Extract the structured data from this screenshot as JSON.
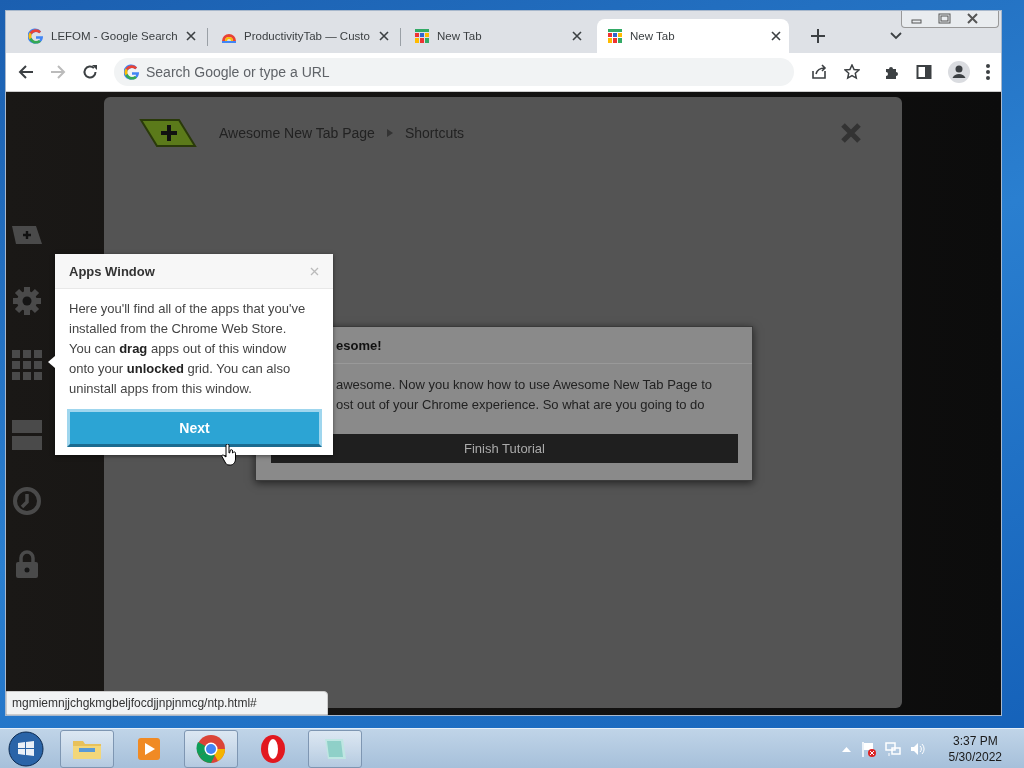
{
  "browser": {
    "tabs": [
      {
        "title": "LEFOM - Google Search",
        "kind": "google",
        "selected": false
      },
      {
        "title": "ProductivityTab — Custo",
        "kind": "rainbow",
        "selected": false
      },
      {
        "title": "New Tab",
        "kind": "grid",
        "selected": false
      },
      {
        "title": "New Tab",
        "kind": "grid",
        "selected": true
      }
    ],
    "omnibox": {
      "placeholder": "Search Google or type a URL"
    },
    "status_url": "mgmiemnjjchgkmgbeljfocdjjnpjnmcg/ntp.html#"
  },
  "sidebar": {
    "items": [
      {
        "kind": "add"
      },
      {
        "kind": "settings"
      },
      {
        "kind": "apps"
      },
      {
        "kind": "widgets"
      },
      {
        "kind": "history"
      },
      {
        "kind": "lock"
      }
    ]
  },
  "panel": {
    "breadcrumb": [
      "Awesome New Tab Page",
      "Shortcuts"
    ]
  },
  "dialog": {
    "title": "esome!",
    "lines": [
      "awesome. Now you know how to use Awesome New Tab Page to",
      "ost out of your Chrome experience. So what are you going to do"
    ],
    "button": "Finish Tutorial"
  },
  "popover": {
    "title": "Apps Window",
    "text": "Here you'll find all of the apps that you've installed from the Chrome Web Store. You can **drag** apps out of this window onto your **unlocked** grid. You can also uninstall apps from this window.",
    "button": "Next"
  },
  "taskbar": {
    "apps": [
      {
        "kind": "explorer",
        "running": true
      },
      {
        "kind": "media",
        "running": false
      },
      {
        "kind": "chrome",
        "running": true
      },
      {
        "kind": "opera",
        "running": false
      },
      {
        "kind": "notepad",
        "running": true
      }
    ],
    "time": "3:37 PM",
    "date": "5/30/2022"
  }
}
